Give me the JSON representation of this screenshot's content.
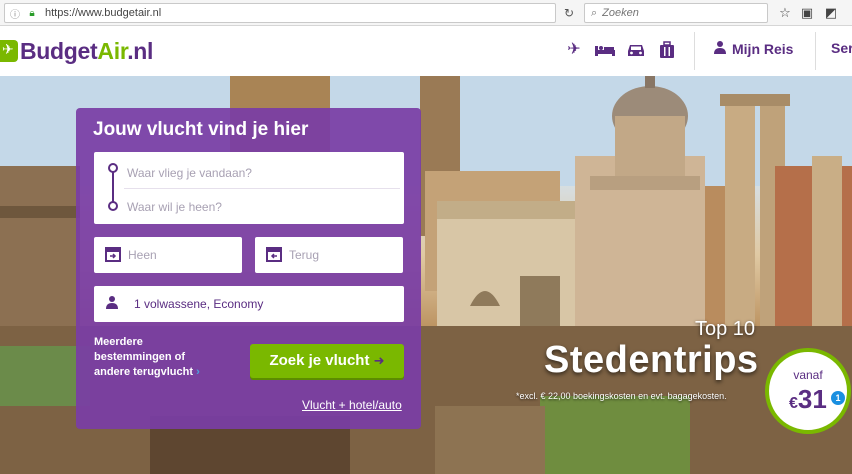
{
  "browser": {
    "url": "https://www.budgetair.nl",
    "search_placeholder": "Zoeken"
  },
  "header": {
    "logo_budget": "Budget",
    "logo_air": "Air",
    "logo_nl": ".nl",
    "nav_icons": [
      "plane-icon",
      "bed-icon",
      "car-icon",
      "luggage-icon"
    ],
    "mijn_reis": "Mijn Reis",
    "service_partial": "Ser"
  },
  "search": {
    "title": "Jouw vlucht vind je hier",
    "from_placeholder": "Waar vlieg je vandaan?",
    "to_placeholder": "Waar wil je heen?",
    "depart": "Heen",
    "return": "Terug",
    "passengers": "1 volwassene,  Economy",
    "multi_line1": "Meerdere",
    "multi_line2": "bestemmingen of",
    "multi_line3": "andere terugvlucht",
    "button": "Zoek je vlucht",
    "hotel_link": "Vlucht + hotel/auto"
  },
  "promo": {
    "top": "Top 10",
    "title": "Stedentrips",
    "note": "*excl. € 22,00 boekingskosten en evt. bagagekosten.",
    "vanaf": "vanaf",
    "currency": "€",
    "price": "31",
    "info_marker": "1"
  },
  "colors": {
    "brand_purple": "#5a2d82",
    "brand_green": "#7ab800",
    "panel_purple": "#7a3da5"
  }
}
